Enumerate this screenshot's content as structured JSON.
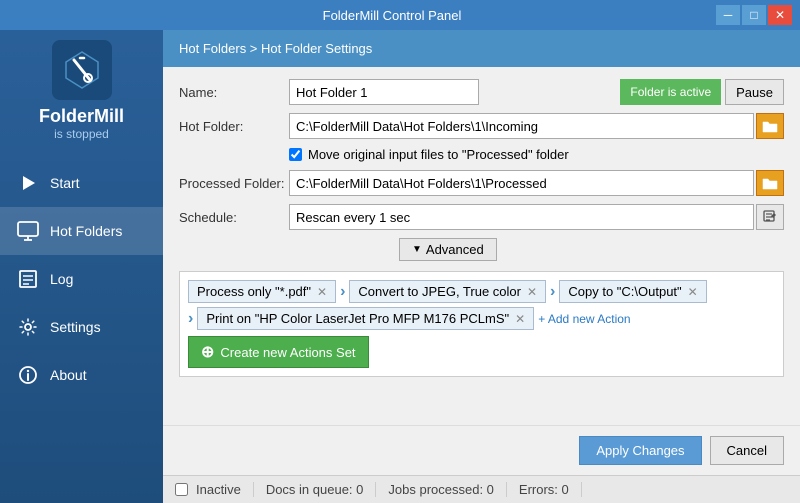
{
  "titleBar": {
    "title": "FolderMill Control Panel",
    "minimizeLabel": "─",
    "maximizeLabel": "□",
    "closeLabel": "✕"
  },
  "sidebar": {
    "logoText": "FolderMill",
    "logoStatus": "is stopped",
    "items": [
      {
        "id": "start",
        "label": "Start",
        "icon": "play-icon"
      },
      {
        "id": "hot-folders",
        "label": "Hot Folders",
        "icon": "tv-icon",
        "active": true
      },
      {
        "id": "log",
        "label": "Log",
        "icon": "list-icon"
      },
      {
        "id": "settings",
        "label": "Settings",
        "icon": "gear-icon"
      },
      {
        "id": "about",
        "label": "About",
        "icon": "info-icon"
      }
    ]
  },
  "contentHeader": {
    "breadcrumb": "Hot Folders > Hot Folder Settings"
  },
  "form": {
    "nameLabel": "Name:",
    "nameValue": "Hot Folder 1",
    "folderIsActiveLabel": "Folder is active",
    "pauseLabel": "Pause",
    "hotFolderLabel": "Hot Folder:",
    "hotFolderValue": "C:\\FolderMill Data\\Hot Folders\\1\\Incoming",
    "moveCheckboxLabel": "Move original input files to \"Processed\" folder",
    "processedFolderLabel": "Processed Folder:",
    "processedFolderValue": "C:\\FolderMill Data\\Hot Folders\\1\\Processed",
    "scheduleLabel": "Schedule:",
    "scheduleValue": "Rescan every 1 sec",
    "advancedLabel": "Advanced"
  },
  "actions": {
    "row1": [
      {
        "label": "Process only \"*.pdf\""
      },
      {
        "label": "Convert to JPEG, True color"
      },
      {
        "label": "Copy to \"C:\\Output\""
      }
    ],
    "row2": [
      {
        "label": "Print on \"HP Color LaserJet Pro MFP M176 PCLmS\""
      }
    ],
    "addNewActionLabel": "+ Add new Action",
    "createSetLabel": "Create new Actions Set"
  },
  "footer": {
    "applyLabel": "Apply Changes",
    "cancelLabel": "Cancel"
  },
  "statusBar": {
    "inactiveLabel": "Inactive",
    "docsInQueueLabel": "Docs in queue: 0",
    "jobsProcessedLabel": "Jobs processed: 0",
    "errorsLabel": "Errors: 0"
  }
}
